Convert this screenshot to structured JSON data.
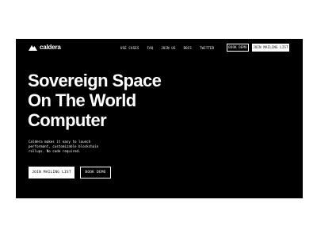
{
  "brand": {
    "name": "caldera",
    "logo_icon": "mountain-logo-icon"
  },
  "nav": {
    "links": [
      "USE CASES",
      "FAQ",
      "JOIN US",
      "DOCS",
      "TWITTER"
    ],
    "book_demo_label": "BOOK DEMO",
    "mailing_list_label": "JOIN MAILING LIST"
  },
  "hero": {
    "title_lines": [
      "Sovereign Space",
      "On The World",
      "Computer"
    ],
    "description_lines": [
      "Caldera makes it easy to launch",
      "performant, customizable blockchain",
      "rollups. No code required."
    ],
    "primary_button_label": "JOIN MAILING LIST",
    "secondary_button_label": "BOOK DEMO"
  },
  "colors": {
    "background": "#000000",
    "foreground": "#ffffff",
    "page": "#ffffff"
  }
}
